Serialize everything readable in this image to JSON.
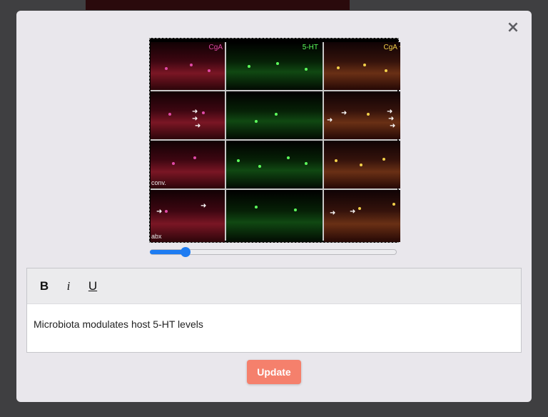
{
  "modal": {
    "close_icon": "×",
    "figure": {
      "panel_labels": [
        "CgA",
        "5-HT",
        "CgA +"
      ],
      "row_labels": [
        "conv.",
        "abx"
      ],
      "colors": {
        "cgA": "#e04aa8",
        "ht": "#5dff5d",
        "merge": "#f2d04a"
      },
      "arrow_glyph": "➜"
    },
    "zoom_slider": {
      "value": 0.13
    },
    "toolbar": {
      "bold_label": "B",
      "italic_label": "i",
      "underline_label": "U"
    },
    "editor": {
      "text": "Microbiota modulates host 5-HT levels"
    },
    "update_label": "Update"
  }
}
